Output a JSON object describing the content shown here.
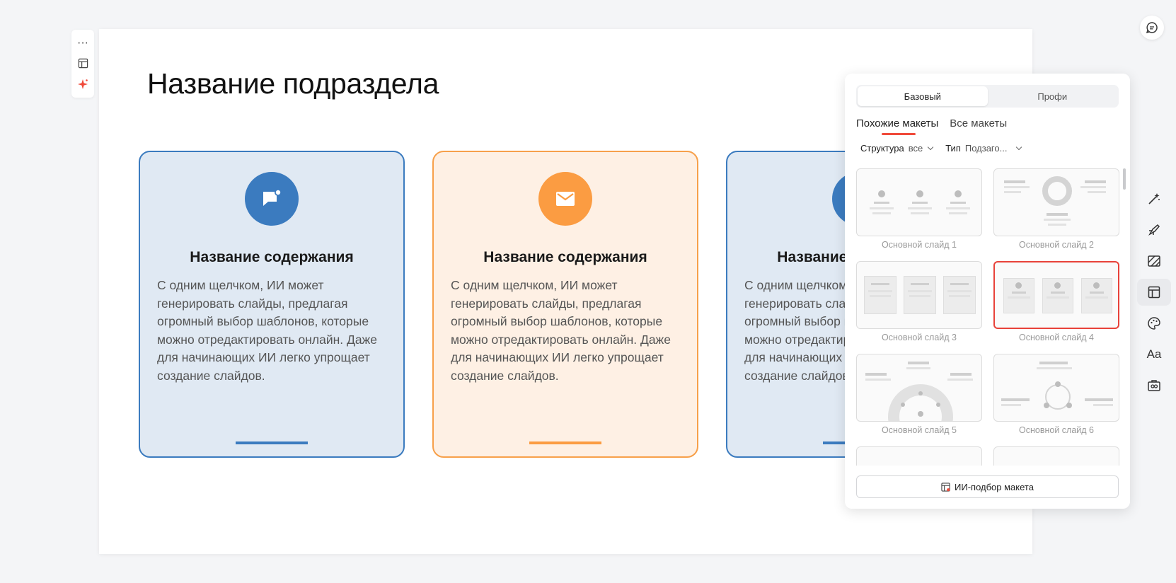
{
  "slide": {
    "title": "Название подраздела",
    "cards": [
      {
        "title": "Название содержания",
        "body": "С одним щелчком, ИИ может генерировать слайды, предлагая огромный выбор шаблонов, которые можно отредактировать онлайн. Даже для начинающих ИИ легко упрощает создание слайдов.",
        "icon": "chat-bubble-icon"
      },
      {
        "title": "Название содержания",
        "body": "С одним щелчком, ИИ может генерировать слайды, предлагая огромный выбор шаблонов, которые можно отредактировать онлайн. Даже для начинающих ИИ легко упрощает создание слайдов.",
        "icon": "envelope-icon"
      },
      {
        "title": "Название содержания",
        "body": "С одним щелчком, ИИ может генерировать слайды, предлагая огромный выбор шаблонов, которые можно отредактировать онлайн. Даже для начинающих ИИ легко упрощает создание слайдов.",
        "icon": "circle-icon"
      }
    ]
  },
  "mini_toolbar": {
    "more": "···"
  },
  "panel": {
    "segments": [
      "Базовый",
      "Профи"
    ],
    "tabs": [
      "Похожие макеты",
      "Все макеты"
    ],
    "filters": {
      "structure_label": "Структура",
      "structure_value": "все",
      "type_label": "Тип",
      "type_value": "Подзаго..."
    },
    "layouts": [
      "Основной слайд 1",
      "Основной слайд 2",
      "Основной слайд 3",
      "Основной слайд 4",
      "Основной слайд 5",
      "Основной слайд 6"
    ],
    "selected_layout": "Основной слайд 4",
    "ai_button": "ИИ-подбор макета"
  },
  "rail": {
    "font_label": "Aa"
  },
  "colors": {
    "blue": "#3b7bbf",
    "orange": "#fb9c42",
    "accent_red": "#e8423a"
  }
}
